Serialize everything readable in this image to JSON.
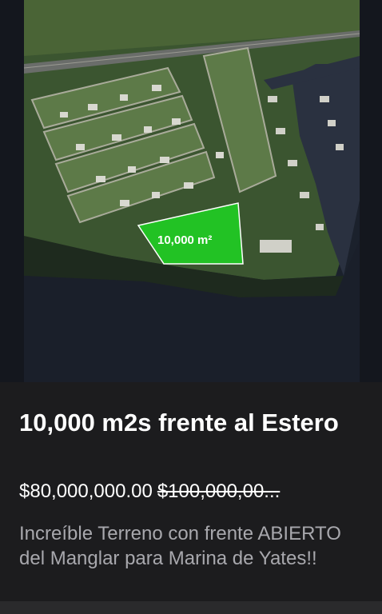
{
  "listing": {
    "title": "10,000 m2s frente al Estero",
    "price_current": "$80,000,000.00",
    "price_original": "$100,000,00...",
    "description": "Increíble Terreno con frente ABIERTO del Manglar para Marina de Yates!!"
  },
  "photo": {
    "area_label": "10,000 m²",
    "colors": {
      "lot_fill": "#22c224",
      "vegetation": "#3d5a2c",
      "water": "#1a1f2a",
      "background": "#151820"
    }
  }
}
